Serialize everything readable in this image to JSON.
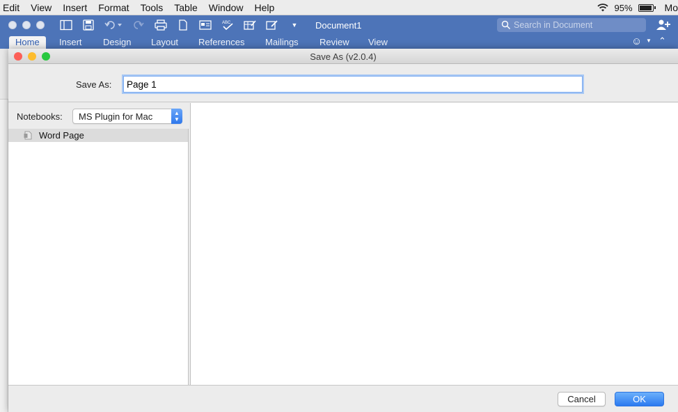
{
  "menubar": {
    "items": [
      "Edit",
      "View",
      "Insert",
      "Format",
      "Tools",
      "Table",
      "Window",
      "Help"
    ],
    "battery_percent": "95%",
    "battery_level": 0.95,
    "trailing_text": "Mo"
  },
  "word": {
    "doc_title": "Document1",
    "search_placeholder": "Search in Document",
    "tabs": [
      "Home",
      "Insert",
      "Design",
      "Layout",
      "References",
      "Mailings",
      "Review",
      "View"
    ],
    "active_tab": "Home"
  },
  "dialog": {
    "title": "Save As (v2.0.4)",
    "save_as_label": "Save As:",
    "save_as_value": "Page 1",
    "notebooks_label": "Notebooks:",
    "notebook_selected": "MS Plugin for Mac",
    "tree_items": [
      {
        "label": "Word Page"
      }
    ],
    "cancel_label": "Cancel",
    "ok_label": "OK"
  },
  "colors": {
    "word_blue": "#4d74b8",
    "accent_blue": "#2b7af0",
    "close": "#fc5f57",
    "minimize": "#fdbc2e",
    "zoom": "#28c840"
  }
}
